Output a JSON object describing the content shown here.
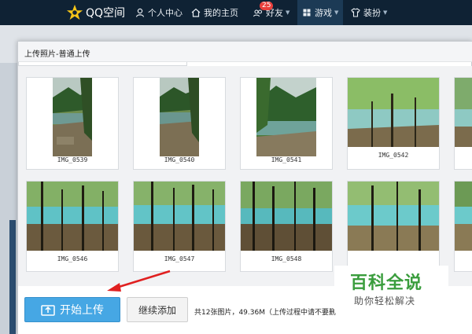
{
  "nav": {
    "logo": "QQ空间",
    "items": [
      {
        "label": "个人中心",
        "icon": "person-icon"
      },
      {
        "label": "我的主页",
        "icon": "home-icon"
      },
      {
        "label": "好友",
        "icon": "friends-icon",
        "badge": "25"
      },
      {
        "label": "游戏",
        "icon": "game-icon"
      },
      {
        "label": "装扮",
        "icon": "shirt-icon"
      }
    ]
  },
  "dialog": {
    "title": "上传照片-普通上传"
  },
  "photos": [
    {
      "name": "IMG_0539"
    },
    {
      "name": "IMG_0540"
    },
    {
      "name": "IMG_0541"
    },
    {
      "name": "IMG_0542"
    },
    {
      "name": "IMG_0546"
    },
    {
      "name": "IMG_0547"
    },
    {
      "name": "IMG_0548"
    }
  ],
  "footer": {
    "start_label": "开始上传",
    "continue_label": "继续添加",
    "status": "共12张图片，49.36M（上传过程中请不要删"
  },
  "watermark": {
    "title": "百科全说",
    "subtitle": "助你轻松解决"
  },
  "colors": {
    "nav_bg": "#0f2234",
    "primary_button": "#46a7e4",
    "watermark_green": "#3a9d3d"
  }
}
